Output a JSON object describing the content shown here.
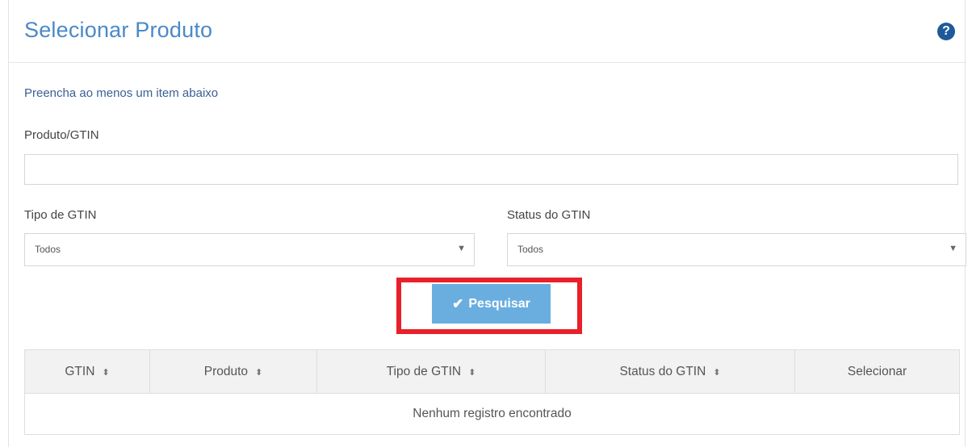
{
  "panel": {
    "title": "Selecionar Produto",
    "help_icon": "question-circle-icon",
    "help_glyph": "?"
  },
  "form": {
    "hint": "Preencha ao menos um item abaixo",
    "produto_label": "Produto/GTIN",
    "produto_value": "",
    "produto_placeholder": "",
    "tipo_label": "Tipo de GTIN",
    "tipo_value": "Todos",
    "status_label": "Status do GTIN",
    "status_value": "Todos",
    "dropdown_icon": "triangle-down-icon",
    "dropdown_glyph": "▼"
  },
  "search_button": {
    "label": "Pesquisar",
    "icon": "check-icon",
    "glyph": "✔",
    "highlight_color": "#e8202a"
  },
  "table": {
    "sort_icon": "sort-icon",
    "sort_glyph": "⬍",
    "columns": [
      "GTIN",
      "Produto",
      "Tipo de GTIN",
      "Status do GTIN",
      "Selecionar"
    ],
    "empty_message": "Nenhum registro encontrado"
  },
  "colors": {
    "title": "#4a89c8",
    "button": "#6aaee0",
    "hint": "#3b5f94"
  }
}
